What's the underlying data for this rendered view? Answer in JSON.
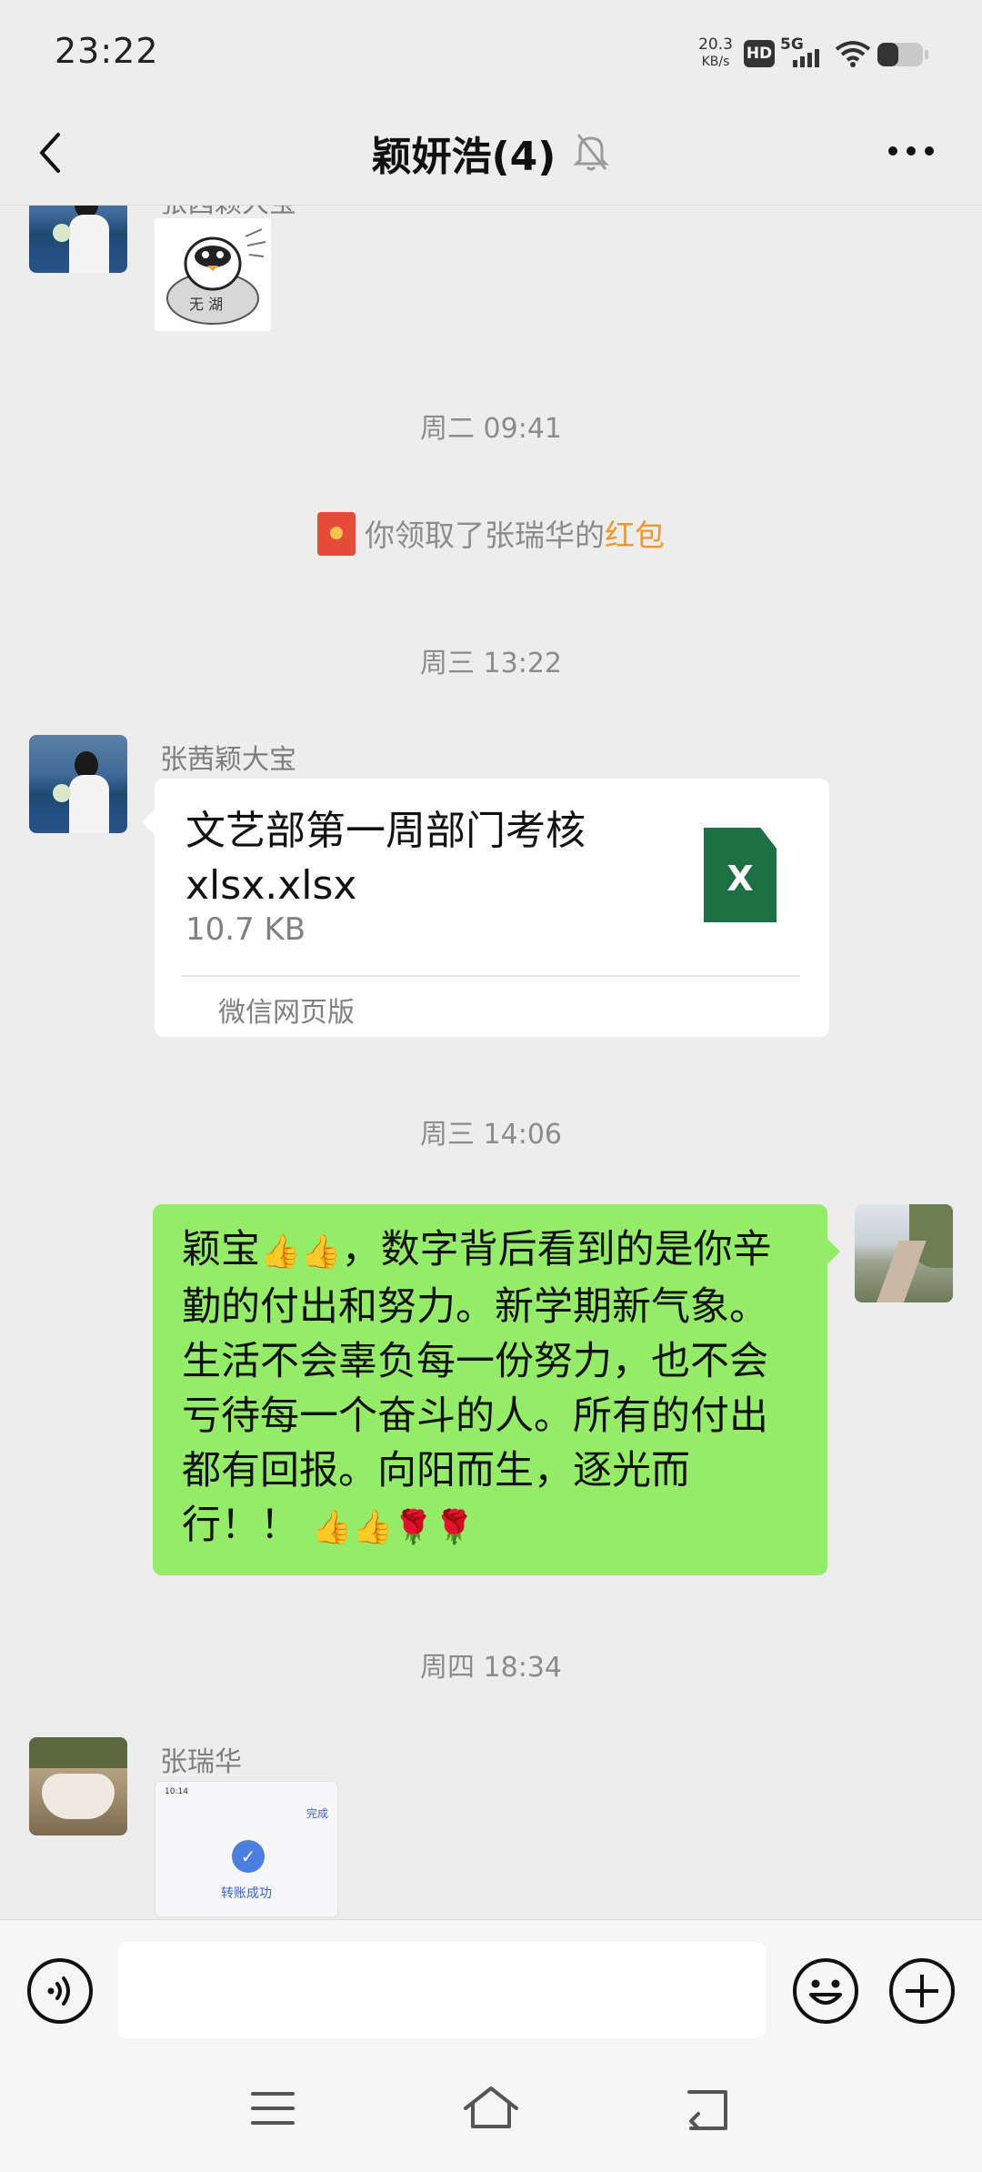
{
  "status_bar": {
    "time": "23:22",
    "net_speed_value": "20.3",
    "net_speed_unit": "KB/s",
    "hd_label": "HD",
    "network": "5G",
    "battery_level": 0.45
  },
  "header": {
    "title": "颖妍浩(4)",
    "muted": true
  },
  "messages": {
    "top_partial_sender": "张茜颖大宝",
    "sticker_text": "无 湖",
    "ts1": "周二 09:41",
    "system_prefix": "你领取了张瑞华的",
    "system_link": "红包",
    "ts2": "周三 13:22",
    "file_sender": "张茜颖大宝",
    "file_name": "文艺部第一周部门考核xlsx.xlsx",
    "file_size": "10.7 KB",
    "file_icon_letter": "X",
    "file_source": "微信网页版",
    "ts3": "周三 14:06",
    "self_text_1": "颖宝",
    "self_text_2": "，数字背后看到的是你辛勤的付出和努力。新学期新气象。生活不会辜负每一份努力，也不会亏待每一个奋斗的人。所有的付出都有回报。向阳而生，逐光而行！！",
    "emoji_thumbs": "👍",
    "emoji_rose": "🌹",
    "ts4": "周四 18:34",
    "last_sender": "张瑞华",
    "transfer_thumb_time": "10:14",
    "transfer_thumb_done": "完成",
    "transfer_thumb_label": "转账成功"
  },
  "input_bar": {
    "placeholder": ""
  },
  "colors": {
    "background": "#ededed",
    "self_bubble": "#95ec69",
    "link_orange": "#f09530",
    "excel_green": "#1d7044"
  },
  "icons": [
    "back-icon",
    "bell-muted-icon",
    "more-icon",
    "voice-icon",
    "emoji-icon",
    "plus-icon",
    "menu-icon",
    "home-icon",
    "back-nav-icon"
  ]
}
